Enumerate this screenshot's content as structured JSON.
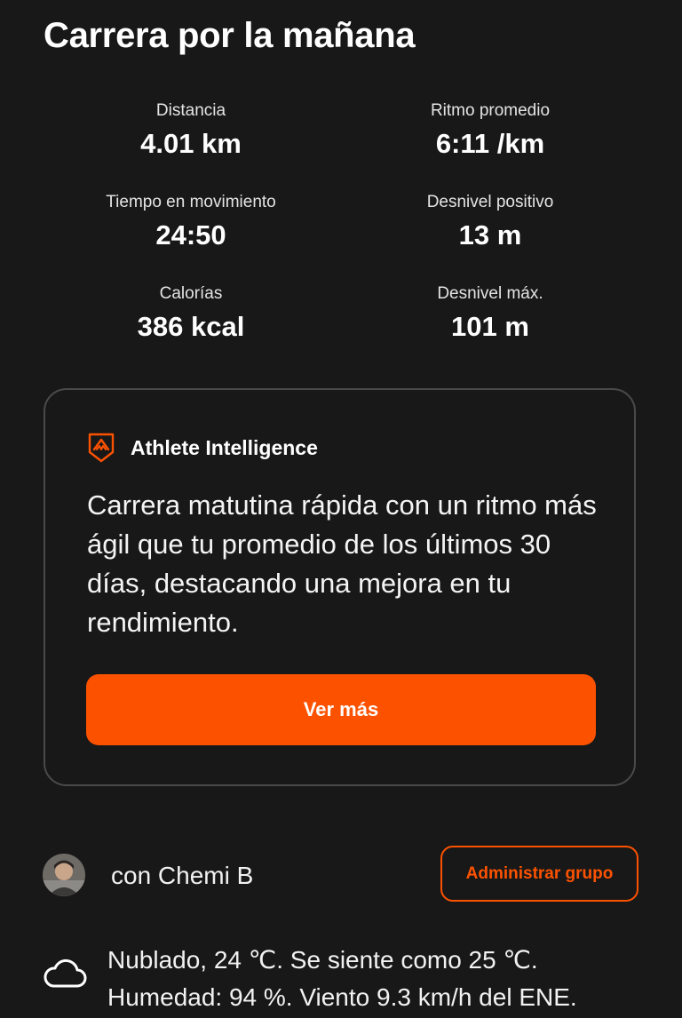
{
  "activity": {
    "title": "Carrera por la mañana"
  },
  "stats": [
    {
      "label": "Distancia",
      "value": "4.01 km"
    },
    {
      "label": "Ritmo promedio",
      "value": "6:11 /km"
    },
    {
      "label": "Tiempo en movimiento",
      "value": "24:50"
    },
    {
      "label": "Desnivel positivo",
      "value": "13 m"
    },
    {
      "label": "Calorías",
      "value": "386 kcal"
    },
    {
      "label": "Desnivel máx.",
      "value": "101 m"
    }
  ],
  "athlete_intelligence": {
    "icon": "athlete-intelligence-icon",
    "title": "Athlete Intelligence",
    "summary": "Carrera matutina rápida con un ritmo más ágil que tu promedio de los últimos 30 días, destacando una mejora en tu rendimiento.",
    "button_label": "Ver más"
  },
  "group": {
    "avatar_icon": "user-avatar",
    "companion_text": "con Chemi B",
    "manage_button_label": "Administrar grupo"
  },
  "weather": {
    "icon": "cloud-icon",
    "line1": "Nublado, 24 ℃. Se siente como 25 ℃.",
    "line2": "Humedad: 94 %. Viento 9.3 km/h del ENE."
  },
  "colors": {
    "background": "#181818",
    "accent": "#fc5200",
    "card_border": "#4a4a4a",
    "text": "#ffffff"
  }
}
